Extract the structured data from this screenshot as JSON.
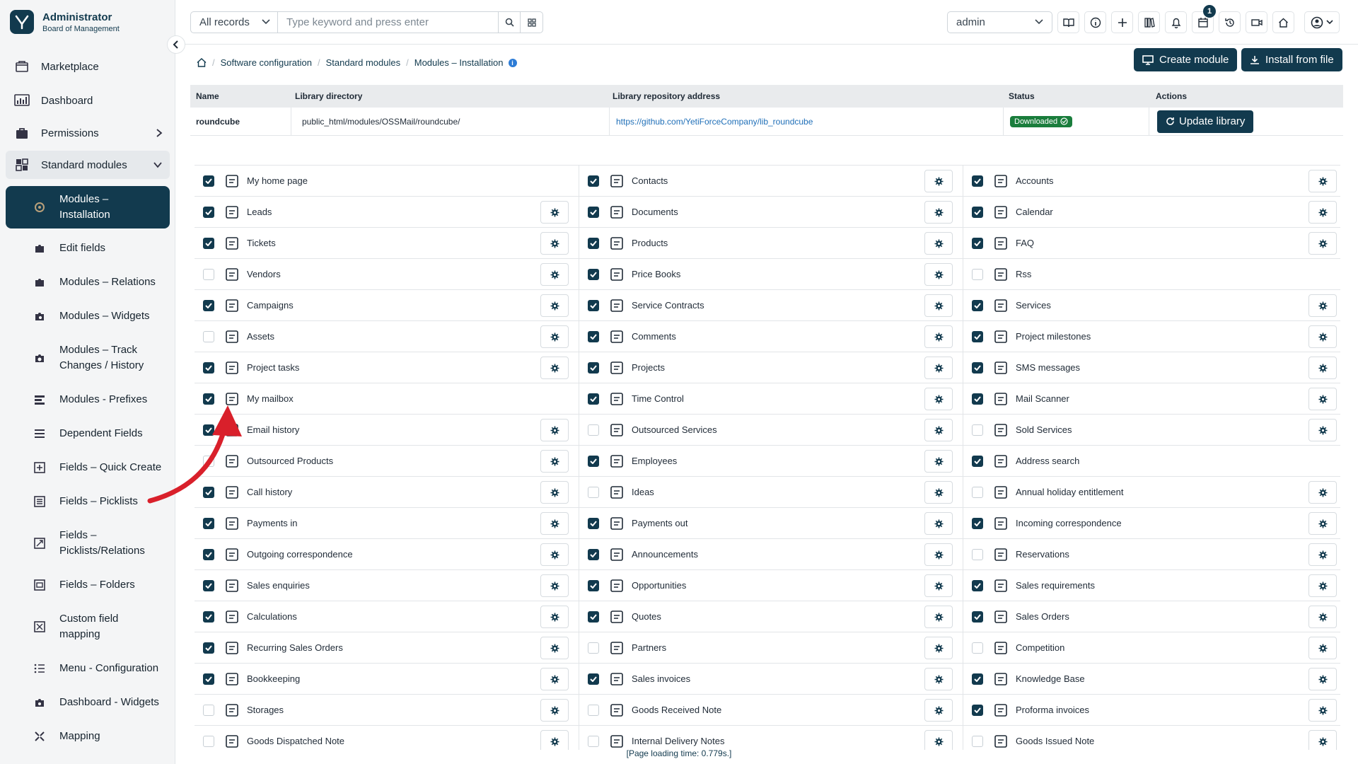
{
  "brand": {
    "title": "Administrator",
    "subtitle": "Board of Management"
  },
  "nav": {
    "top_items": [
      {
        "label": "Marketplace",
        "icon": "marketplace-icon"
      },
      {
        "label": "Dashboard",
        "icon": "dashboard-icon"
      },
      {
        "label": "Permissions",
        "icon": "permissions-icon"
      },
      {
        "label": "Standard modules",
        "icon": "standard-modules-icon"
      }
    ],
    "sub_items": [
      {
        "label": "Modules – Installation"
      },
      {
        "label": "Edit fields"
      },
      {
        "label": "Modules – Relations"
      },
      {
        "label": "Modules – Widgets"
      },
      {
        "label": "Modules – Track Changes / History"
      },
      {
        "label": "Modules - Prefixes"
      },
      {
        "label": "Dependent Fields"
      },
      {
        "label": "Fields – Quick Create"
      },
      {
        "label": "Fields – Picklists"
      },
      {
        "label": "Fields – Picklists/Relations"
      },
      {
        "label": "Fields – Folders"
      },
      {
        "label": "Custom field mapping"
      },
      {
        "label": "Menu - Configuration"
      },
      {
        "label": "Dashboard - Widgets"
      },
      {
        "label": "Mapping"
      }
    ]
  },
  "header": {
    "search_scope": "All records",
    "search_placeholder": "Type keyword and press enter",
    "user_select": "admin",
    "notification_count": "1"
  },
  "breadcrumb": [
    "Software configuration",
    "Standard modules",
    "Modules – Installation"
  ],
  "actions": {
    "create_module": "Create module",
    "install_from_file": "Install from file"
  },
  "library_table": {
    "headers": [
      "Name",
      "Library directory",
      "Library repository address",
      "Status",
      "Actions"
    ],
    "row": {
      "name": "roundcube",
      "directory": "public_html/modules/OSSMail/roundcube/",
      "repository": "https://github.com/YetiForceCompany/lib_roundcube",
      "status": "Downloaded",
      "action": "Update library"
    }
  },
  "modules": {
    "col1": [
      {
        "name": "My home page",
        "checked": true,
        "gear": false
      },
      {
        "name": "Leads",
        "checked": true,
        "gear": true
      },
      {
        "name": "Tickets",
        "checked": true,
        "gear": true
      },
      {
        "name": "Vendors",
        "checked": false,
        "gear": true
      },
      {
        "name": "Campaigns",
        "checked": true,
        "gear": true
      },
      {
        "name": "Assets",
        "checked": false,
        "gear": true
      },
      {
        "name": "Project tasks",
        "checked": true,
        "gear": true
      },
      {
        "name": "My mailbox",
        "checked": true,
        "gear": false
      },
      {
        "name": "Email history",
        "checked": true,
        "gear": true
      },
      {
        "name": "Outsourced Products",
        "checked": false,
        "gear": true
      },
      {
        "name": "Call history",
        "checked": true,
        "gear": true
      },
      {
        "name": "Payments in",
        "checked": true,
        "gear": true
      },
      {
        "name": "Outgoing correspondence",
        "checked": true,
        "gear": true
      },
      {
        "name": "Sales enquiries",
        "checked": true,
        "gear": true
      },
      {
        "name": "Calculations",
        "checked": true,
        "gear": true
      },
      {
        "name": "Recurring Sales Orders",
        "checked": true,
        "gear": true
      },
      {
        "name": "Bookkeeping",
        "checked": true,
        "gear": true
      },
      {
        "name": "Storages",
        "checked": false,
        "gear": true
      },
      {
        "name": "Goods Dispatched Note",
        "checked": false,
        "gear": true
      }
    ],
    "col2": [
      {
        "name": "Contacts",
        "checked": true,
        "gear": true
      },
      {
        "name": "Documents",
        "checked": true,
        "gear": true
      },
      {
        "name": "Products",
        "checked": true,
        "gear": true
      },
      {
        "name": "Price Books",
        "checked": true,
        "gear": true
      },
      {
        "name": "Service Contracts",
        "checked": true,
        "gear": true
      },
      {
        "name": "Comments",
        "checked": true,
        "gear": true
      },
      {
        "name": "Projects",
        "checked": true,
        "gear": true
      },
      {
        "name": "Time Control",
        "checked": true,
        "gear": true
      },
      {
        "name": "Outsourced Services",
        "checked": false,
        "gear": true
      },
      {
        "name": "Employees",
        "checked": true,
        "gear": true
      },
      {
        "name": "Ideas",
        "checked": false,
        "gear": true
      },
      {
        "name": "Payments out",
        "checked": true,
        "gear": true
      },
      {
        "name": "Announcements",
        "checked": true,
        "gear": true
      },
      {
        "name": "Opportunities",
        "checked": true,
        "gear": true
      },
      {
        "name": "Quotes",
        "checked": true,
        "gear": true
      },
      {
        "name": "Partners",
        "checked": false,
        "gear": true
      },
      {
        "name": "Sales invoices",
        "checked": true,
        "gear": true
      },
      {
        "name": "Goods Received Note",
        "checked": false,
        "gear": true
      },
      {
        "name": "Internal Delivery Notes",
        "checked": false,
        "gear": true
      }
    ],
    "col3": [
      {
        "name": "Accounts",
        "checked": true,
        "gear": true
      },
      {
        "name": "Calendar",
        "checked": true,
        "gear": true
      },
      {
        "name": "FAQ",
        "checked": true,
        "gear": true
      },
      {
        "name": "Rss",
        "checked": false,
        "gear": false
      },
      {
        "name": "Services",
        "checked": true,
        "gear": true
      },
      {
        "name": "Project milestones",
        "checked": true,
        "gear": true
      },
      {
        "name": "SMS messages",
        "checked": true,
        "gear": true
      },
      {
        "name": "Mail Scanner",
        "checked": true,
        "gear": true
      },
      {
        "name": "Sold Services",
        "checked": false,
        "gear": true
      },
      {
        "name": "Address search",
        "checked": true,
        "gear": false
      },
      {
        "name": "Annual holiday entitlement",
        "checked": false,
        "gear": true
      },
      {
        "name": "Incoming correspondence",
        "checked": true,
        "gear": true
      },
      {
        "name": "Reservations",
        "checked": false,
        "gear": true
      },
      {
        "name": "Sales requirements",
        "checked": true,
        "gear": true
      },
      {
        "name": "Sales Orders",
        "checked": true,
        "gear": true
      },
      {
        "name": "Competition",
        "checked": false,
        "gear": true
      },
      {
        "name": "Knowledge Base",
        "checked": true,
        "gear": true
      },
      {
        "name": "Proforma invoices",
        "checked": true,
        "gear": true
      },
      {
        "name": "Goods Issued Note",
        "checked": false,
        "gear": true
      }
    ]
  },
  "footer": {
    "loading_time": "[Page loading time: 0.779s.]"
  },
  "colors": {
    "primary": "#123a4e",
    "accent_red": "#d9202b",
    "status_green": "#1a7d3c"
  }
}
